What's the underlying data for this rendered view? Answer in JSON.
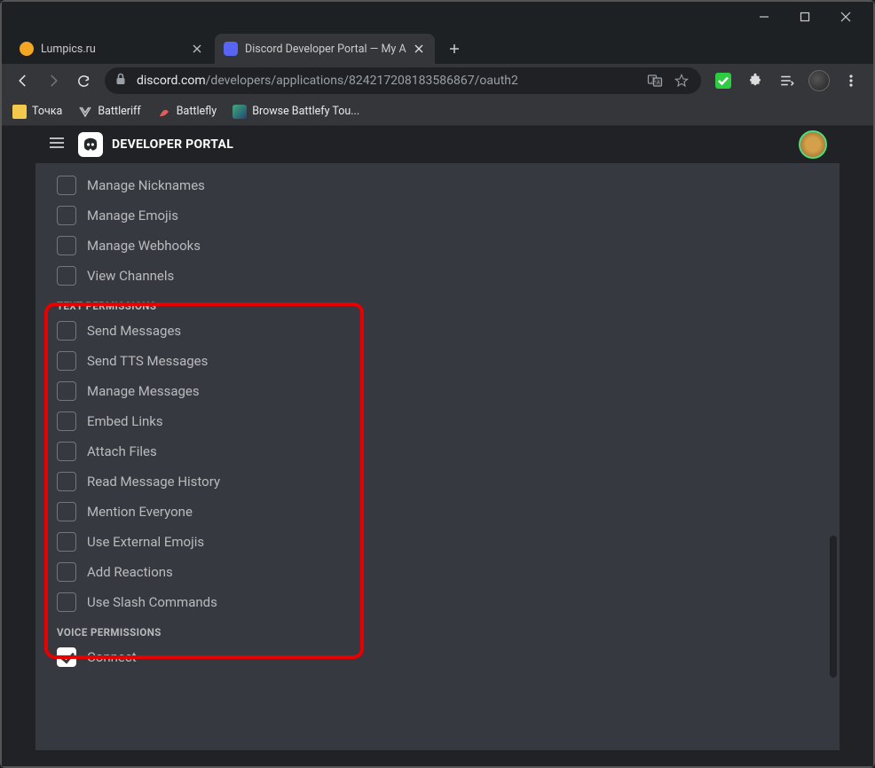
{
  "window_controls": {
    "min": "minimize",
    "max": "maximize",
    "close": "close"
  },
  "tabs": [
    {
      "title": "Lumpics.ru",
      "active": false,
      "favicon_color": "#f5a623"
    },
    {
      "title": "Discord Developer Portal — My A",
      "active": true,
      "favicon_color": "#5865f2"
    }
  ],
  "addressbar": {
    "host": "discord.com",
    "path": "/developers/applications/824217208183586867/oauth2"
  },
  "bookmarks": [
    {
      "label": "Точка",
      "color": "#f2c94c"
    },
    {
      "label": "Battleriff",
      "color": "#999"
    },
    {
      "label": "Battlefly",
      "color": "#e05d5d"
    },
    {
      "label": "Browse Battlefy Tou...",
      "color": "#3a7"
    }
  ],
  "portal_title": "DEVELOPER PORTAL",
  "general_top_items": [
    {
      "label": "Manage Nicknames",
      "checked": false
    },
    {
      "label": "Manage Emojis",
      "checked": false
    },
    {
      "label": "Manage Webhooks",
      "checked": false
    },
    {
      "label": "View Channels",
      "checked": false
    }
  ],
  "text_permissions": {
    "title": "TEXT PERMISSIONS",
    "items": [
      {
        "label": "Send Messages",
        "checked": false
      },
      {
        "label": "Send TTS Messages",
        "checked": false
      },
      {
        "label": "Manage Messages",
        "checked": false
      },
      {
        "label": "Embed Links",
        "checked": false
      },
      {
        "label": "Attach Files",
        "checked": false
      },
      {
        "label": "Read Message History",
        "checked": false
      },
      {
        "label": "Mention Everyone",
        "checked": false
      },
      {
        "label": "Use External Emojis",
        "checked": false
      },
      {
        "label": "Add Reactions",
        "checked": false
      },
      {
        "label": "Use Slash Commands",
        "checked": false
      }
    ]
  },
  "voice_permissions": {
    "title": "VOICE PERMISSIONS",
    "items": [
      {
        "label": "Connect",
        "checked": true
      }
    ]
  }
}
